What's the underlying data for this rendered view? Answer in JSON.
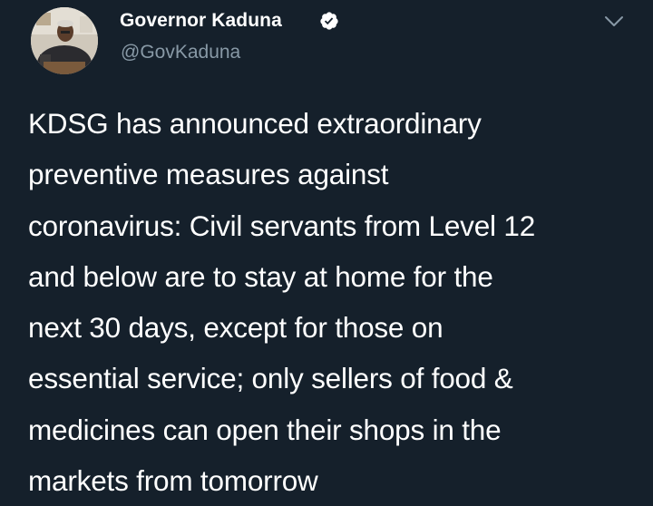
{
  "author": {
    "display_name": "Governor Kaduna",
    "handle": "@GovKaduna",
    "verified": true,
    "avatar_icon": "profile-photo-avatar"
  },
  "menu": {
    "icon": "chevron-down-icon"
  },
  "tweet": {
    "lines": [
      "KDSG has announced extraordinary",
      "preventive measures against",
      "coronavirus: Civil servants from Level 12",
      "and below are to stay at home for the",
      "next 30 days, except for those on",
      "essential service; only sellers of food &",
      "medicines can open their shops in the",
      "markets from tomorrow"
    ]
  },
  "colors": {
    "background": "#15202b",
    "text_primary": "#ffffff",
    "text_secondary": "#8899a6",
    "verified_badge": "#ffffff"
  }
}
